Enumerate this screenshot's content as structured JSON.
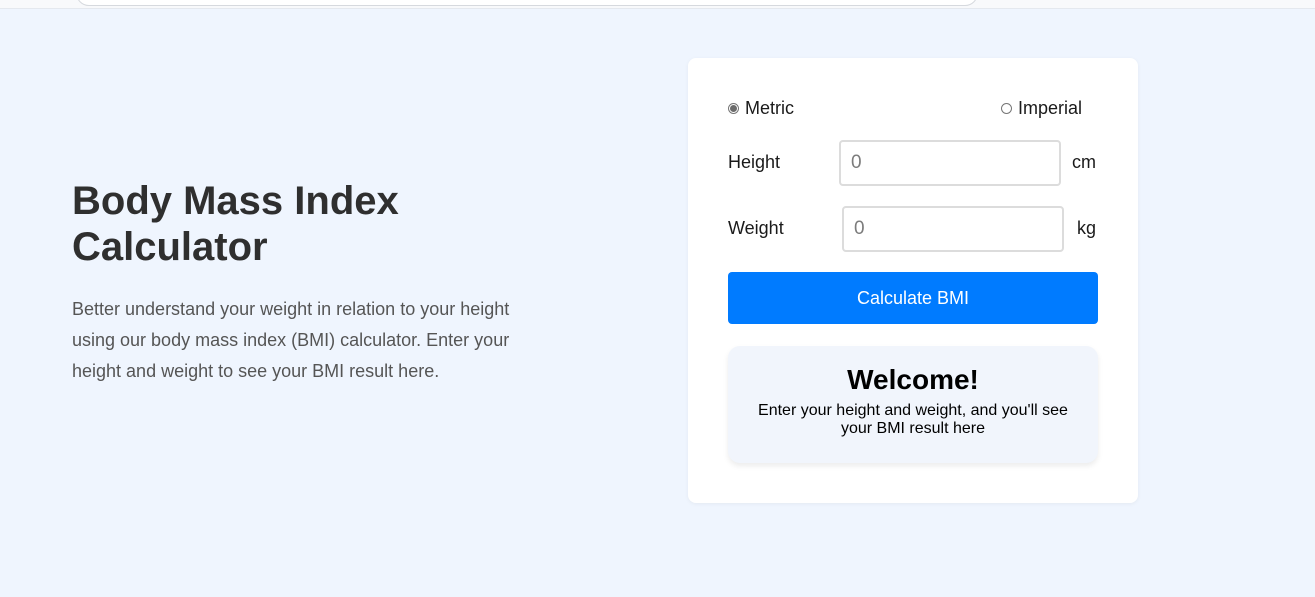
{
  "hero": {
    "title": "Body Mass Index Calculator",
    "description": "Better understand your weight in relation to your height using our body mass index (BMI) calculator. Enter your height and weight to see your BMI result here."
  },
  "form": {
    "units": {
      "metric_label": "Metric",
      "imperial_label": "Imperial",
      "selected": "Metric"
    },
    "height": {
      "label": "Height",
      "placeholder": "0",
      "unit": "cm"
    },
    "weight": {
      "label": "Weight",
      "placeholder": "0",
      "unit": "kg"
    },
    "submit_label": "Calculate BMI"
  },
  "result": {
    "title": "Welcome!",
    "message": "Enter your height and weight, and you'll see your BMI result here"
  },
  "colors": {
    "page_background": "#eff5fe",
    "button": "#007bff",
    "result_background": "#f1f5fc"
  }
}
